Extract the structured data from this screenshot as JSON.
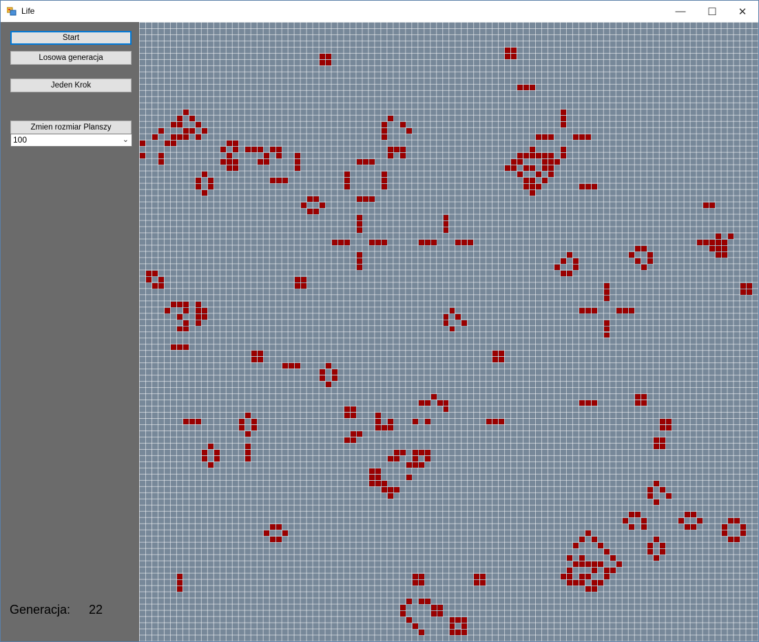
{
  "window": {
    "title": "Life",
    "minimize_label": "—",
    "maximize_label": "☐",
    "close_label": "✕"
  },
  "controls": {
    "start_label": "Start",
    "random_label": "Losowa generacja",
    "step_label": "Jeden Krok",
    "resize_label": "Zmien rozmiar Planszy",
    "board_size": "100"
  },
  "status": {
    "generation_label": "Generacja:",
    "generation_value": "22"
  },
  "board": {
    "columns": 100,
    "rows": 100,
    "dead_color": "#778899",
    "grid_color": "#d8dde3",
    "live_color": "#990000",
    "live_cells": [
      [
        29,
        5
      ],
      [
        30,
        5
      ],
      [
        29,
        6
      ],
      [
        30,
        6
      ],
      [
        59,
        4
      ],
      [
        60,
        4
      ],
      [
        59,
        5
      ],
      [
        60,
        5
      ],
      [
        61,
        10
      ],
      [
        62,
        10
      ],
      [
        63,
        10
      ],
      [
        7,
        14
      ],
      [
        6,
        15
      ],
      [
        8,
        15
      ],
      [
        5,
        16
      ],
      [
        6,
        16
      ],
      [
        9,
        16
      ],
      [
        3,
        17
      ],
      [
        7,
        17
      ],
      [
        8,
        17
      ],
      [
        10,
        17
      ],
      [
        2,
        18
      ],
      [
        5,
        18
      ],
      [
        6,
        18
      ],
      [
        7,
        18
      ],
      [
        9,
        18
      ],
      [
        4,
        19
      ],
      [
        5,
        19
      ],
      [
        0,
        19
      ],
      [
        0,
        21
      ],
      [
        3,
        21
      ],
      [
        3,
        22
      ],
      [
        14,
        19
      ],
      [
        15,
        19
      ],
      [
        13,
        20
      ],
      [
        15,
        20
      ],
      [
        17,
        20
      ],
      [
        18,
        20
      ],
      [
        19,
        20
      ],
      [
        21,
        20
      ],
      [
        22,
        20
      ],
      [
        14,
        21
      ],
      [
        20,
        21
      ],
      [
        22,
        21
      ],
      [
        13,
        22
      ],
      [
        14,
        22
      ],
      [
        15,
        22
      ],
      [
        19,
        22
      ],
      [
        20,
        22
      ],
      [
        14,
        23
      ],
      [
        15,
        23
      ],
      [
        25,
        21
      ],
      [
        25,
        22
      ],
      [
        25,
        23
      ],
      [
        21,
        25
      ],
      [
        22,
        25
      ],
      [
        23,
        25
      ],
      [
        10,
        24
      ],
      [
        9,
        25
      ],
      [
        11,
        25
      ],
      [
        9,
        26
      ],
      [
        11,
        26
      ],
      [
        10,
        27
      ],
      [
        40,
        15
      ],
      [
        39,
        16
      ],
      [
        42,
        16
      ],
      [
        39,
        17
      ],
      [
        43,
        17
      ],
      [
        39,
        18
      ],
      [
        40,
        20
      ],
      [
        41,
        20
      ],
      [
        42,
        20
      ],
      [
        40,
        21
      ],
      [
        42,
        21
      ],
      [
        35,
        22
      ],
      [
        36,
        22
      ],
      [
        37,
        22
      ],
      [
        33,
        24
      ],
      [
        33,
        25
      ],
      [
        33,
        26
      ],
      [
        39,
        24
      ],
      [
        39,
        25
      ],
      [
        39,
        26
      ],
      [
        35,
        28
      ],
      [
        36,
        28
      ],
      [
        37,
        28
      ],
      [
        27,
        28
      ],
      [
        28,
        28
      ],
      [
        26,
        29
      ],
      [
        29,
        29
      ],
      [
        27,
        30
      ],
      [
        28,
        30
      ],
      [
        35,
        31
      ],
      [
        35,
        32
      ],
      [
        35,
        33
      ],
      [
        31,
        35
      ],
      [
        32,
        35
      ],
      [
        33,
        35
      ],
      [
        37,
        35
      ],
      [
        38,
        35
      ],
      [
        39,
        35
      ],
      [
        35,
        37
      ],
      [
        35,
        38
      ],
      [
        35,
        39
      ],
      [
        49,
        31
      ],
      [
        49,
        32
      ],
      [
        49,
        33
      ],
      [
        45,
        35
      ],
      [
        46,
        35
      ],
      [
        47,
        35
      ],
      [
        51,
        35
      ],
      [
        52,
        35
      ],
      [
        53,
        35
      ],
      [
        68,
        14
      ],
      [
        68,
        15
      ],
      [
        68,
        16
      ],
      [
        64,
        18
      ],
      [
        65,
        18
      ],
      [
        66,
        18
      ],
      [
        70,
        18
      ],
      [
        71,
        18
      ],
      [
        72,
        18
      ],
      [
        63,
        20
      ],
      [
        68,
        20
      ],
      [
        61,
        21
      ],
      [
        62,
        21
      ],
      [
        63,
        21
      ],
      [
        64,
        21
      ],
      [
        65,
        21
      ],
      [
        66,
        21
      ],
      [
        68,
        21
      ],
      [
        60,
        22
      ],
      [
        61,
        22
      ],
      [
        65,
        22
      ],
      [
        66,
        22
      ],
      [
        67,
        22
      ],
      [
        59,
        23
      ],
      [
        60,
        23
      ],
      [
        62,
        23
      ],
      [
        63,
        23
      ],
      [
        65,
        23
      ],
      [
        66,
        23
      ],
      [
        61,
        24
      ],
      [
        64,
        24
      ],
      [
        66,
        24
      ],
      [
        62,
        25
      ],
      [
        63,
        25
      ],
      [
        65,
        25
      ],
      [
        62,
        26
      ],
      [
        63,
        26
      ],
      [
        64,
        26
      ],
      [
        63,
        27
      ],
      [
        71,
        26
      ],
      [
        72,
        26
      ],
      [
        73,
        26
      ],
      [
        91,
        29
      ],
      [
        92,
        29
      ],
      [
        93,
        34
      ],
      [
        92,
        35
      ],
      [
        95,
        34
      ],
      [
        90,
        35
      ],
      [
        91,
        35
      ],
      [
        93,
        35
      ],
      [
        94,
        35
      ],
      [
        92,
        36
      ],
      [
        93,
        36
      ],
      [
        94,
        36
      ],
      [
        93,
        37
      ],
      [
        94,
        37
      ],
      [
        69,
        37
      ],
      [
        68,
        38
      ],
      [
        70,
        38
      ],
      [
        67,
        39
      ],
      [
        70,
        39
      ],
      [
        68,
        40
      ],
      [
        69,
        40
      ],
      [
        80,
        36
      ],
      [
        81,
        36
      ],
      [
        79,
        37
      ],
      [
        82,
        37
      ],
      [
        80,
        38
      ],
      [
        82,
        38
      ],
      [
        81,
        39
      ],
      [
        97,
        42
      ],
      [
        98,
        42
      ],
      [
        97,
        43
      ],
      [
        98,
        43
      ],
      [
        1,
        40
      ],
      [
        2,
        40
      ],
      [
        1,
        41
      ],
      [
        3,
        41
      ],
      [
        2,
        42
      ],
      [
        3,
        42
      ],
      [
        25,
        41
      ],
      [
        26,
        41
      ],
      [
        25,
        42
      ],
      [
        26,
        42
      ],
      [
        5,
        45
      ],
      [
        6,
        45
      ],
      [
        7,
        45
      ],
      [
        9,
        45
      ],
      [
        4,
        46
      ],
      [
        7,
        46
      ],
      [
        9,
        46
      ],
      [
        10,
        46
      ],
      [
        6,
        47
      ],
      [
        9,
        47
      ],
      [
        10,
        47
      ],
      [
        7,
        48
      ],
      [
        9,
        48
      ],
      [
        6,
        49
      ],
      [
        7,
        49
      ],
      [
        5,
        52
      ],
      [
        6,
        52
      ],
      [
        7,
        52
      ],
      [
        75,
        42
      ],
      [
        75,
        43
      ],
      [
        75,
        44
      ],
      [
        71,
        46
      ],
      [
        72,
        46
      ],
      [
        73,
        46
      ],
      [
        77,
        46
      ],
      [
        78,
        46
      ],
      [
        79,
        46
      ],
      [
        75,
        48
      ],
      [
        75,
        49
      ],
      [
        75,
        50
      ],
      [
        50,
        46
      ],
      [
        49,
        47
      ],
      [
        51,
        47
      ],
      [
        49,
        48
      ],
      [
        52,
        48
      ],
      [
        50,
        49
      ],
      [
        18,
        53
      ],
      [
        19,
        53
      ],
      [
        18,
        54
      ],
      [
        19,
        54
      ],
      [
        23,
        55
      ],
      [
        24,
        55
      ],
      [
        25,
        55
      ],
      [
        30,
        55
      ],
      [
        29,
        56
      ],
      [
        31,
        56
      ],
      [
        29,
        57
      ],
      [
        31,
        57
      ],
      [
        30,
        58
      ],
      [
        57,
        53
      ],
      [
        58,
        53
      ],
      [
        57,
        54
      ],
      [
        58,
        54
      ],
      [
        47,
        60
      ],
      [
        45,
        61
      ],
      [
        46,
        61
      ],
      [
        48,
        61
      ],
      [
        49,
        61
      ],
      [
        49,
        62
      ],
      [
        33,
        62
      ],
      [
        34,
        62
      ],
      [
        33,
        63
      ],
      [
        34,
        63
      ],
      [
        38,
        63
      ],
      [
        38,
        64
      ],
      [
        38,
        65
      ],
      [
        39,
        65
      ],
      [
        40,
        65
      ],
      [
        40,
        64
      ],
      [
        44,
        64
      ],
      [
        46,
        64
      ],
      [
        71,
        61
      ],
      [
        72,
        61
      ],
      [
        73,
        61
      ],
      [
        80,
        60
      ],
      [
        81,
        60
      ],
      [
        80,
        61
      ],
      [
        81,
        61
      ],
      [
        56,
        64
      ],
      [
        57,
        64
      ],
      [
        58,
        64
      ],
      [
        7,
        64
      ],
      [
        8,
        64
      ],
      [
        9,
        64
      ],
      [
        17,
        63
      ],
      [
        16,
        64
      ],
      [
        18,
        64
      ],
      [
        16,
        65
      ],
      [
        18,
        65
      ],
      [
        17,
        66
      ],
      [
        17,
        68
      ],
      [
        17,
        69
      ],
      [
        17,
        70
      ],
      [
        34,
        66
      ],
      [
        35,
        66
      ],
      [
        33,
        67
      ],
      [
        34,
        67
      ],
      [
        11,
        68
      ],
      [
        10,
        69
      ],
      [
        12,
        69
      ],
      [
        10,
        70
      ],
      [
        12,
        70
      ],
      [
        11,
        71
      ],
      [
        41,
        69
      ],
      [
        42,
        69
      ],
      [
        44,
        69
      ],
      [
        45,
        69
      ],
      [
        46,
        69
      ],
      [
        40,
        70
      ],
      [
        41,
        70
      ],
      [
        44,
        70
      ],
      [
        46,
        70
      ],
      [
        43,
        71
      ],
      [
        44,
        71
      ],
      [
        45,
        71
      ],
      [
        37,
        72
      ],
      [
        38,
        72
      ],
      [
        37,
        73
      ],
      [
        38,
        73
      ],
      [
        43,
        73
      ],
      [
        37,
        74
      ],
      [
        38,
        74
      ],
      [
        39,
        74
      ],
      [
        39,
        75
      ],
      [
        40,
        75
      ],
      [
        41,
        75
      ],
      [
        40,
        76
      ],
      [
        84,
        64
      ],
      [
        85,
        64
      ],
      [
        84,
        65
      ],
      [
        85,
        65
      ],
      [
        83,
        74
      ],
      [
        82,
        75
      ],
      [
        84,
        75
      ],
      [
        82,
        76
      ],
      [
        85,
        76
      ],
      [
        83,
        77
      ],
      [
        83,
        67
      ],
      [
        84,
        67
      ],
      [
        83,
        68
      ],
      [
        84,
        68
      ],
      [
        79,
        79
      ],
      [
        80,
        79
      ],
      [
        78,
        80
      ],
      [
        81,
        80
      ],
      [
        79,
        81
      ],
      [
        81,
        81
      ],
      [
        88,
        79
      ],
      [
        89,
        79
      ],
      [
        87,
        80
      ],
      [
        90,
        80
      ],
      [
        88,
        81
      ],
      [
        89,
        81
      ],
      [
        95,
        80
      ],
      [
        96,
        80
      ],
      [
        94,
        81
      ],
      [
        97,
        81
      ],
      [
        94,
        82
      ],
      [
        97,
        82
      ],
      [
        95,
        83
      ],
      [
        96,
        83
      ],
      [
        21,
        81
      ],
      [
        22,
        81
      ],
      [
        20,
        82
      ],
      [
        23,
        82
      ],
      [
        21,
        83
      ],
      [
        22,
        83
      ],
      [
        72,
        82
      ],
      [
        71,
        83
      ],
      [
        73,
        83
      ],
      [
        70,
        84
      ],
      [
        74,
        84
      ],
      [
        75,
        85
      ],
      [
        69,
        86
      ],
      [
        71,
        86
      ],
      [
        76,
        86
      ],
      [
        70,
        87
      ],
      [
        71,
        87
      ],
      [
        72,
        87
      ],
      [
        73,
        87
      ],
      [
        74,
        87
      ],
      [
        77,
        87
      ],
      [
        69,
        88
      ],
      [
        73,
        88
      ],
      [
        75,
        88
      ],
      [
        76,
        88
      ],
      [
        68,
        89
      ],
      [
        69,
        89
      ],
      [
        71,
        89
      ],
      [
        72,
        89
      ],
      [
        75,
        89
      ],
      [
        69,
        90
      ],
      [
        70,
        90
      ],
      [
        71,
        90
      ],
      [
        73,
        90
      ],
      [
        74,
        90
      ],
      [
        72,
        91
      ],
      [
        73,
        91
      ],
      [
        83,
        83
      ],
      [
        82,
        84
      ],
      [
        84,
        84
      ],
      [
        82,
        85
      ],
      [
        84,
        85
      ],
      [
        83,
        86
      ],
      [
        6,
        89
      ],
      [
        6,
        90
      ],
      [
        6,
        91
      ],
      [
        44,
        89
      ],
      [
        45,
        89
      ],
      [
        44,
        90
      ],
      [
        45,
        90
      ],
      [
        54,
        89
      ],
      [
        55,
        89
      ],
      [
        54,
        90
      ],
      [
        55,
        90
      ],
      [
        43,
        93
      ],
      [
        45,
        93
      ],
      [
        46,
        93
      ],
      [
        42,
        94
      ],
      [
        47,
        94
      ],
      [
        48,
        94
      ],
      [
        42,
        95
      ],
      [
        47,
        95
      ],
      [
        48,
        95
      ],
      [
        43,
        96
      ],
      [
        50,
        96
      ],
      [
        51,
        96
      ],
      [
        52,
        96
      ],
      [
        44,
        97
      ],
      [
        50,
        97
      ],
      [
        52,
        97
      ],
      [
        45,
        98
      ],
      [
        50,
        98
      ],
      [
        51,
        98
      ],
      [
        52,
        98
      ]
    ]
  }
}
